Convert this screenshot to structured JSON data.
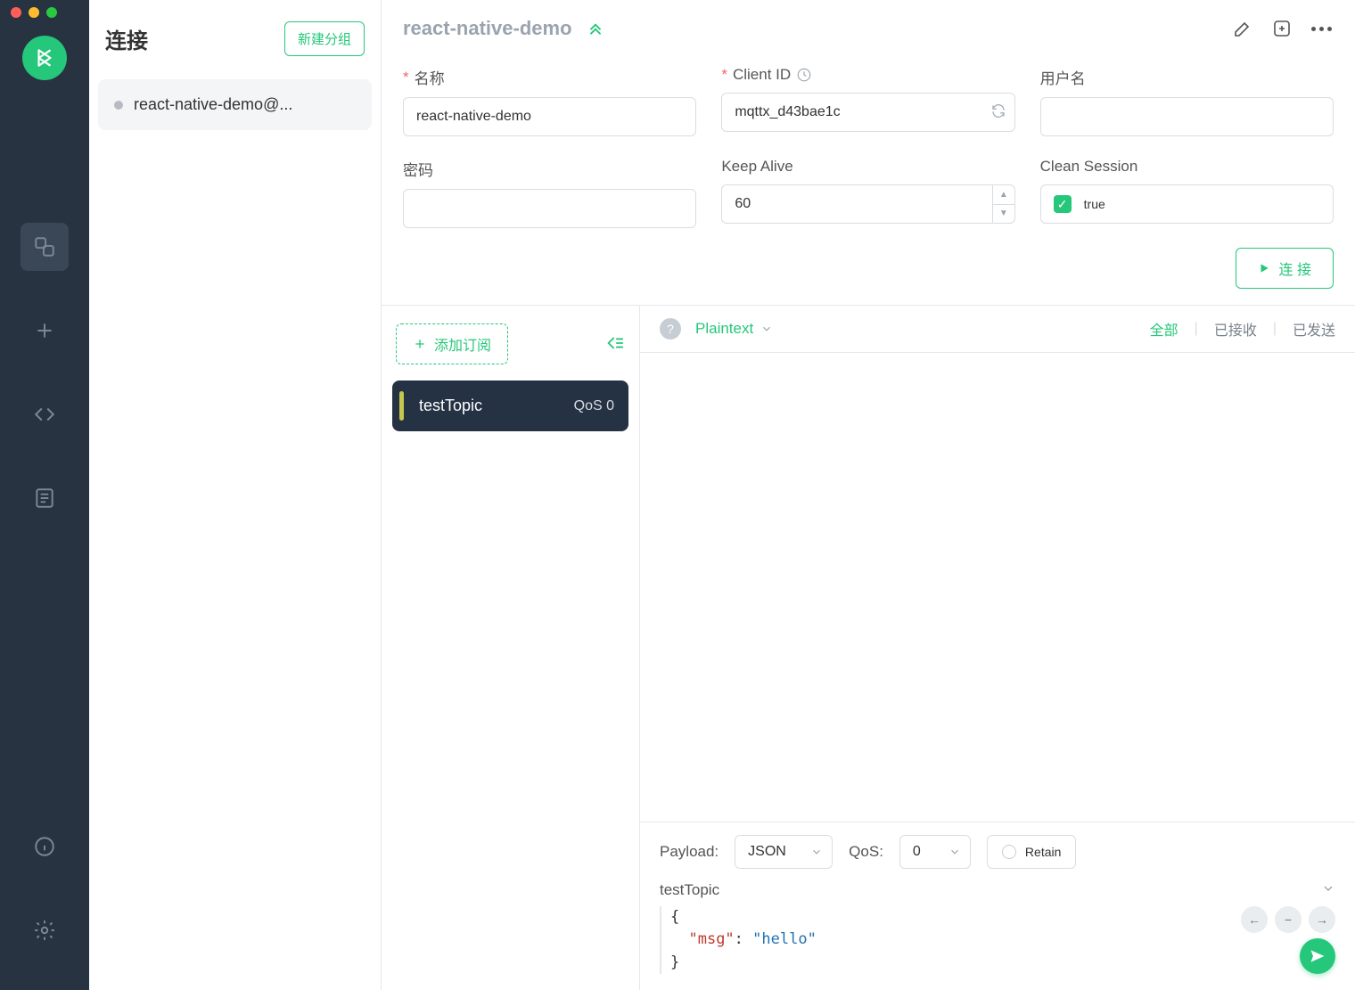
{
  "colors": {
    "accent": "#25c77a",
    "railBg": "#273341",
    "cardBg": "#253244"
  },
  "connlist": {
    "title": "连接",
    "new_group": "新建分组",
    "items": [
      {
        "name": "react-native-demo@..."
      }
    ]
  },
  "header": {
    "title": "react-native-demo"
  },
  "form": {
    "name_label": "名称",
    "name_value": "react-native-demo",
    "clientid_label": "Client ID",
    "clientid_value": "mqttx_d43bae1c",
    "username_label": "用户名",
    "username_value": "",
    "password_label": "密码",
    "password_value": "",
    "keepalive_label": "Keep Alive",
    "keepalive_value": "60",
    "clean_label": "Clean Session",
    "clean_value": "true",
    "connect_btn": "连 接"
  },
  "subs": {
    "add_btn": "添加订阅",
    "items": [
      {
        "topic": "testTopic",
        "qos": "QoS 0"
      }
    ]
  },
  "msgbar": {
    "format": "Plaintext",
    "tabs": {
      "all": "全部",
      "received": "已接收",
      "sent": "已发送"
    }
  },
  "publish": {
    "payload_label": "Payload:",
    "payload_type": "JSON",
    "qos_label": "QoS:",
    "qos_value": "0",
    "retain_label": "Retain",
    "topic": "testTopic",
    "body_key": "\"msg\"",
    "body_val": "\"hello\""
  }
}
